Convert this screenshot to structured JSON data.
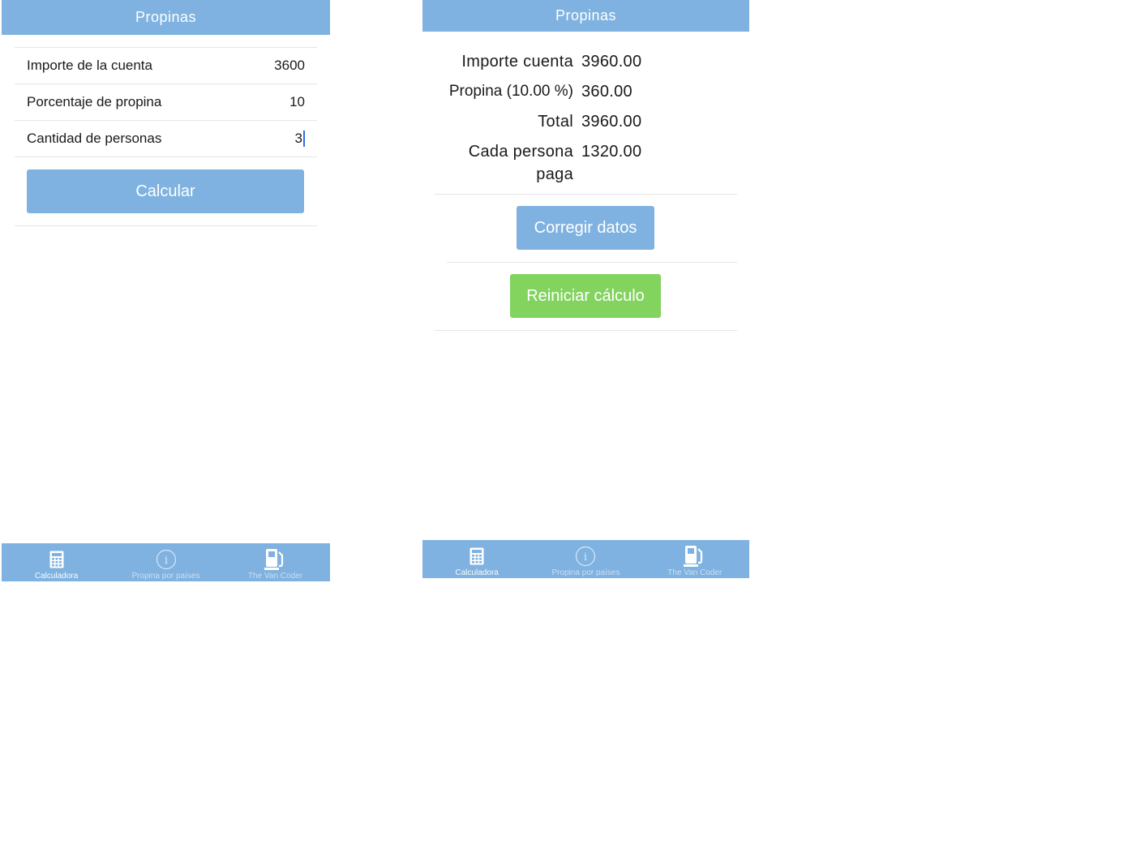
{
  "left": {
    "title": "Propinas",
    "fields": [
      {
        "label": "Importe de la cuenta",
        "value": "3600"
      },
      {
        "label": "Porcentaje de propina",
        "value": "10"
      },
      {
        "label": "Cantidad de personas",
        "value": "3"
      }
    ],
    "calc_label": "Calcular"
  },
  "right": {
    "title": "Propinas",
    "results": [
      {
        "label": "Importe cuenta",
        "value": "3960.00"
      },
      {
        "label": "Propina (10.00 %)",
        "value": "360.00"
      },
      {
        "label": "Total",
        "value": "3960.00"
      },
      {
        "label": "Cada persona paga",
        "value": "1320.00"
      }
    ],
    "corregir_label": "Corregir datos",
    "reiniciar_label": "Reiniciar cálculo"
  },
  "tabs": [
    {
      "label": "Calculadora",
      "icon": "calculator-icon"
    },
    {
      "label": "Propina por países",
      "icon": "info-icon"
    },
    {
      "label": "The Van Coder",
      "icon": "fuel-pump-icon"
    }
  ],
  "colors": {
    "accent": "#7fb2e0",
    "green": "#83d35f",
    "caret": "#2f6fe0"
  }
}
